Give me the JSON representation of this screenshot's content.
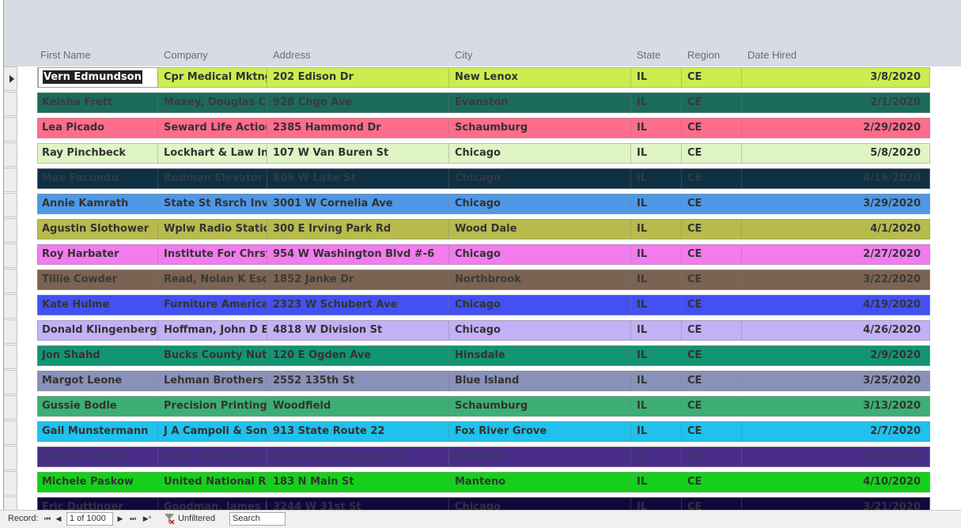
{
  "columns": [
    "First Name",
    "Company",
    "Address",
    "City",
    "State",
    "Region",
    "Date Hired"
  ],
  "rows": [
    {
      "first": "Vern Edmundson",
      "company": "Cpr Medical Mktng &",
      "address": "202 Edison Dr",
      "city": "New Lenox",
      "state": "IL",
      "region": "CE",
      "date": "3/8/2020",
      "bg": "#ceec50",
      "fg": "#333333"
    },
    {
      "first": "Keisha Frett",
      "company": "Maxey, Douglas C",
      "address": "928 Chgo Ave",
      "city": "Evanston",
      "state": "IL",
      "region": "CE",
      "date": "2/1/2020",
      "bg": "#1b6b5b",
      "fg": "#3a3a3a"
    },
    {
      "first": "Lea Picado",
      "company": "Seward Life Action C",
      "address": "2385 Hammond Dr",
      "city": "Schaumburg",
      "state": "IL",
      "region": "CE",
      "date": "2/29/2020",
      "bg": "#fe6d8c",
      "fg": "#333333"
    },
    {
      "first": "Ray Pinchbeck",
      "company": "Lockhart & Law Ins A",
      "address": "107 W Van Buren St",
      "city": "Chicago",
      "state": "IL",
      "region": "CE",
      "date": "5/8/2020",
      "bg": "#dff5c5",
      "fg": "#333333"
    },
    {
      "first": "Mae Facundo",
      "company": "Rodman Elevator",
      "address": "809 W Lake St",
      "city": "Chicago",
      "state": "IL",
      "region": "CE",
      "date": "4/16/2020",
      "bg": "#0f2f43",
      "fg": "#303c44"
    },
    {
      "first": "Annie Kamrath",
      "company": "State St Rsrch Invstm",
      "address": "3001 W Cornelia Ave",
      "city": "Chicago",
      "state": "IL",
      "region": "CE",
      "date": "3/29/2020",
      "bg": "#4e98e6",
      "fg": "#333333"
    },
    {
      "first": "Agustin Slothower",
      "company": "Wplw Radio Station",
      "address": "300 E Irving Park Rd",
      "city": "Wood Dale",
      "state": "IL",
      "region": "CE",
      "date": "4/1/2020",
      "bg": "#b8bb4c",
      "fg": "#333333"
    },
    {
      "first": "Roy Harbater",
      "company": "Institute For Chrstn S",
      "address": "954 W Washington Blvd  #-6",
      "city": "Chicago",
      "state": "IL",
      "region": "CE",
      "date": "2/27/2020",
      "bg": "#f27cee",
      "fg": "#333333"
    },
    {
      "first": "Tillie Cowder",
      "company": "Read, Nolan K Esq",
      "address": "1852 Janke Dr",
      "city": "Northbrook",
      "state": "IL",
      "region": "CE",
      "date": "3/22/2020",
      "bg": "#7a6352",
      "fg": "#3a3a3a"
    },
    {
      "first": "Kate Hulme",
      "company": "Furniture America In",
      "address": "2323 W Schubert Ave",
      "city": "Chicago",
      "state": "IL",
      "region": "CE",
      "date": "4/19/2020",
      "bg": "#4250f4",
      "fg": "#333333"
    },
    {
      "first": "Donald Klingenberger",
      "company": "Hoffman, John D Esq",
      "address": "4818 W Division St",
      "city": "Chicago",
      "state": "IL",
      "region": "CE",
      "date": "4/26/2020",
      "bg": "#c1b1f6",
      "fg": "#333333"
    },
    {
      "first": "Jon Shahd",
      "company": "Bucks County Nut &",
      "address": "120 E Ogden Ave",
      "city": "Hinsdale",
      "state": "IL",
      "region": "CE",
      "date": "2/9/2020",
      "bg": "#139473",
      "fg": "#333333"
    },
    {
      "first": "Margot Leone",
      "company": "Lehman Brothers",
      "address": "2552 135th St",
      "city": "Blue Island",
      "state": "IL",
      "region": "CE",
      "date": "3/25/2020",
      "bg": "#8a91b8",
      "fg": "#333333"
    },
    {
      "first": "Gussie Bodle",
      "company": "Precision Printing",
      "address": "Woodfield",
      "city": "Schaumburg",
      "state": "IL",
      "region": "CE",
      "date": "3/13/2020",
      "bg": "#3dae74",
      "fg": "#333333"
    },
    {
      "first": "Gail Munstermann",
      "company": "J A Campoli & Sons",
      "address": "913 State Route 22",
      "city": "Fox River Grove",
      "state": "IL",
      "region": "CE",
      "date": "2/7/2020",
      "bg": "#20c1ec",
      "fg": "#333333"
    },
    {
      "first": "Clifford Ferron",
      "company": "Post, William Esq",
      "address": "5131 Dixie Highway St",
      "city": "Kokakee",
      "state": "IL",
      "region": "CE",
      "date": "3/10/2020",
      "bg": "#482c88",
      "fg": "#3c3566"
    },
    {
      "first": "Michele Paskow",
      "company": "United National Rea",
      "address": "183 N Main St",
      "city": "Manteno",
      "state": "IL",
      "region": "CE",
      "date": "4/10/2020",
      "bg": "#15d01a",
      "fg": "#333333"
    },
    {
      "first": "Eric Duttinger",
      "company": "Goodman, James L E",
      "address": "3244 W 31st St",
      "city": "Chicago",
      "state": "IL",
      "region": "CE",
      "date": "3/21/2020",
      "bg": "#10083a",
      "fg": "#303040"
    }
  ],
  "status": {
    "record_label": "Record:",
    "record_value": "1 of 1000",
    "filter_label": "Unfiltered",
    "search_label": "Search",
    "nav_first": "⏮",
    "nav_prev": "◀",
    "nav_next": "▶",
    "nav_last": "⏭",
    "nav_new": "▶*"
  }
}
